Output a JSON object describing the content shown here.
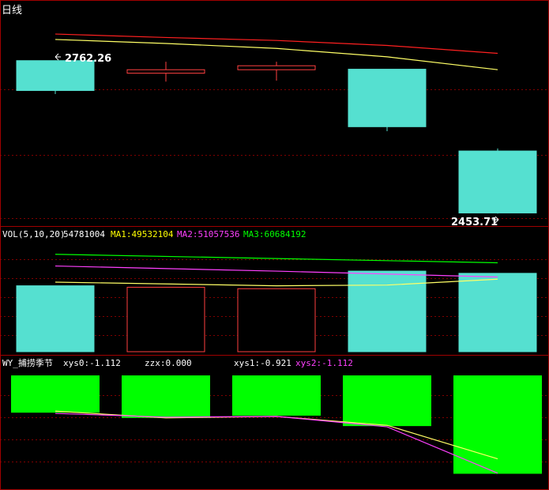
{
  "colors": {
    "background": "#000000",
    "frame": "#a00000",
    "grid": "#800000",
    "up_candle": "#ff4040",
    "down_candle": "#55e0d0",
    "ma_red": "#ff2020",
    "ma_yellow": "#ffff66",
    "ma_green": "#00ff00",
    "ma_magenta": "#ff40ff",
    "bar_green": "#00ff00",
    "text_white": "#ffffff",
    "text_yellow": "#ffff00",
    "text_magenta": "#ff40ff",
    "text_green": "#00ff00"
  },
  "chart_data": {
    "type": "candlestick-with-indicators",
    "panels": {
      "price": {
        "title": "日线",
        "high_label": "2762.26",
        "low_label": "2453.71",
        "ylim": [
          2435,
          2840
        ],
        "candles": [
          {
            "open": 2762.3,
            "close": 2702.0,
            "high": 2762.3,
            "low": 2695.0,
            "dir": "down"
          },
          {
            "open": 2737.0,
            "close": 2744.0,
            "high": 2760.0,
            "low": 2720.0,
            "dir": "up"
          },
          {
            "open": 2744.0,
            "close": 2752.0,
            "high": 2760.0,
            "low": 2722.0,
            "dir": "up"
          },
          {
            "open": 2745.0,
            "close": 2629.0,
            "high": 2745.0,
            "low": 2620.0,
            "dir": "down"
          },
          {
            "open": 2580.0,
            "close": 2455.0,
            "high": 2585.0,
            "low": 2453.7,
            "dir": "down"
          }
        ],
        "ma_lines": [
          {
            "color_key": "ma_red",
            "points": [
              {
                "x": 0,
                "y": 2816
              },
              {
                "x": 1,
                "y": 2809
              },
              {
                "x": 2,
                "y": 2803
              },
              {
                "x": 3,
                "y": 2793
              },
              {
                "x": 4,
                "y": 2777
              }
            ]
          },
          {
            "color_key": "ma_yellow",
            "points": [
              {
                "x": 0,
                "y": 2805
              },
              {
                "x": 1,
                "y": 2797
              },
              {
                "x": 2,
                "y": 2787
              },
              {
                "x": 3,
                "y": 2770
              },
              {
                "x": 4,
                "y": 2744
              }
            ]
          }
        ]
      },
      "volume": {
        "label_name": "VOL(5,10,20)",
        "label_value": "54781004",
        "ma1_text": "MA1:49532104",
        "ma2_text": "MA2:51057536",
        "ma3_text": "MA3:60684192",
        "ylim": [
          0,
          75000000
        ],
        "bars": [
          {
            "value": 45000000,
            "dir": "down"
          },
          {
            "value": 44000000,
            "dir": "up"
          },
          {
            "value": 43000000,
            "dir": "up"
          },
          {
            "value": 55000000,
            "dir": "down"
          },
          {
            "value": 53500000,
            "dir": "down"
          }
        ],
        "ma_lines": [
          {
            "color_key": "ma_green",
            "points": [
              {
                "x": 0,
                "y": 66500000
              },
              {
                "x": 4,
                "y": 60700000
              }
            ]
          },
          {
            "color_key": "ma_magenta",
            "points": [
              {
                "x": 0,
                "y": 58500000
              },
              {
                "x": 2,
                "y": 55000000
              },
              {
                "x": 4,
                "y": 51000000
              }
            ]
          },
          {
            "color_key": "ma_yellow",
            "points": [
              {
                "x": 0,
                "y": 47500000
              },
              {
                "x": 2,
                "y": 45000000
              },
              {
                "x": 3,
                "y": 45500000
              },
              {
                "x": 4,
                "y": 49500000
              }
            ]
          }
        ]
      },
      "indicator": {
        "label_name": "WY_捕捞季节",
        "xys0_text": "xys0:-1.112",
        "zzx_text": "zzx:0.000",
        "xys1_text": "xys1:-0.921",
        "xys2_text": "xys2:-1.112",
        "ylim": [
          -1.2,
          0.2
        ],
        "bars": [
          {
            "top": 0.2,
            "bottom": -0.3
          },
          {
            "top": 0.2,
            "bottom": -0.37
          },
          {
            "top": 0.2,
            "bottom": -0.34
          },
          {
            "top": 0.2,
            "bottom": -0.48
          },
          {
            "top": 0.2,
            "bottom": -1.12
          }
        ],
        "lines": [
          {
            "color_key": "ma_yellow",
            "points": [
              {
                "x": 0,
                "y": -0.28
              },
              {
                "x": 1,
                "y": -0.37
              },
              {
                "x": 2,
                "y": -0.35
              },
              {
                "x": 3,
                "y": -0.47
              },
              {
                "x": 4,
                "y": -0.92
              }
            ]
          },
          {
            "color_key": "ma_magenta",
            "points": [
              {
                "x": 0,
                "y": -0.31
              },
              {
                "x": 1,
                "y": -0.36
              },
              {
                "x": 2,
                "y": -0.35
              },
              {
                "x": 3,
                "y": -0.49
              },
              {
                "x": 4,
                "y": -1.112
              }
            ]
          }
        ]
      }
    }
  }
}
